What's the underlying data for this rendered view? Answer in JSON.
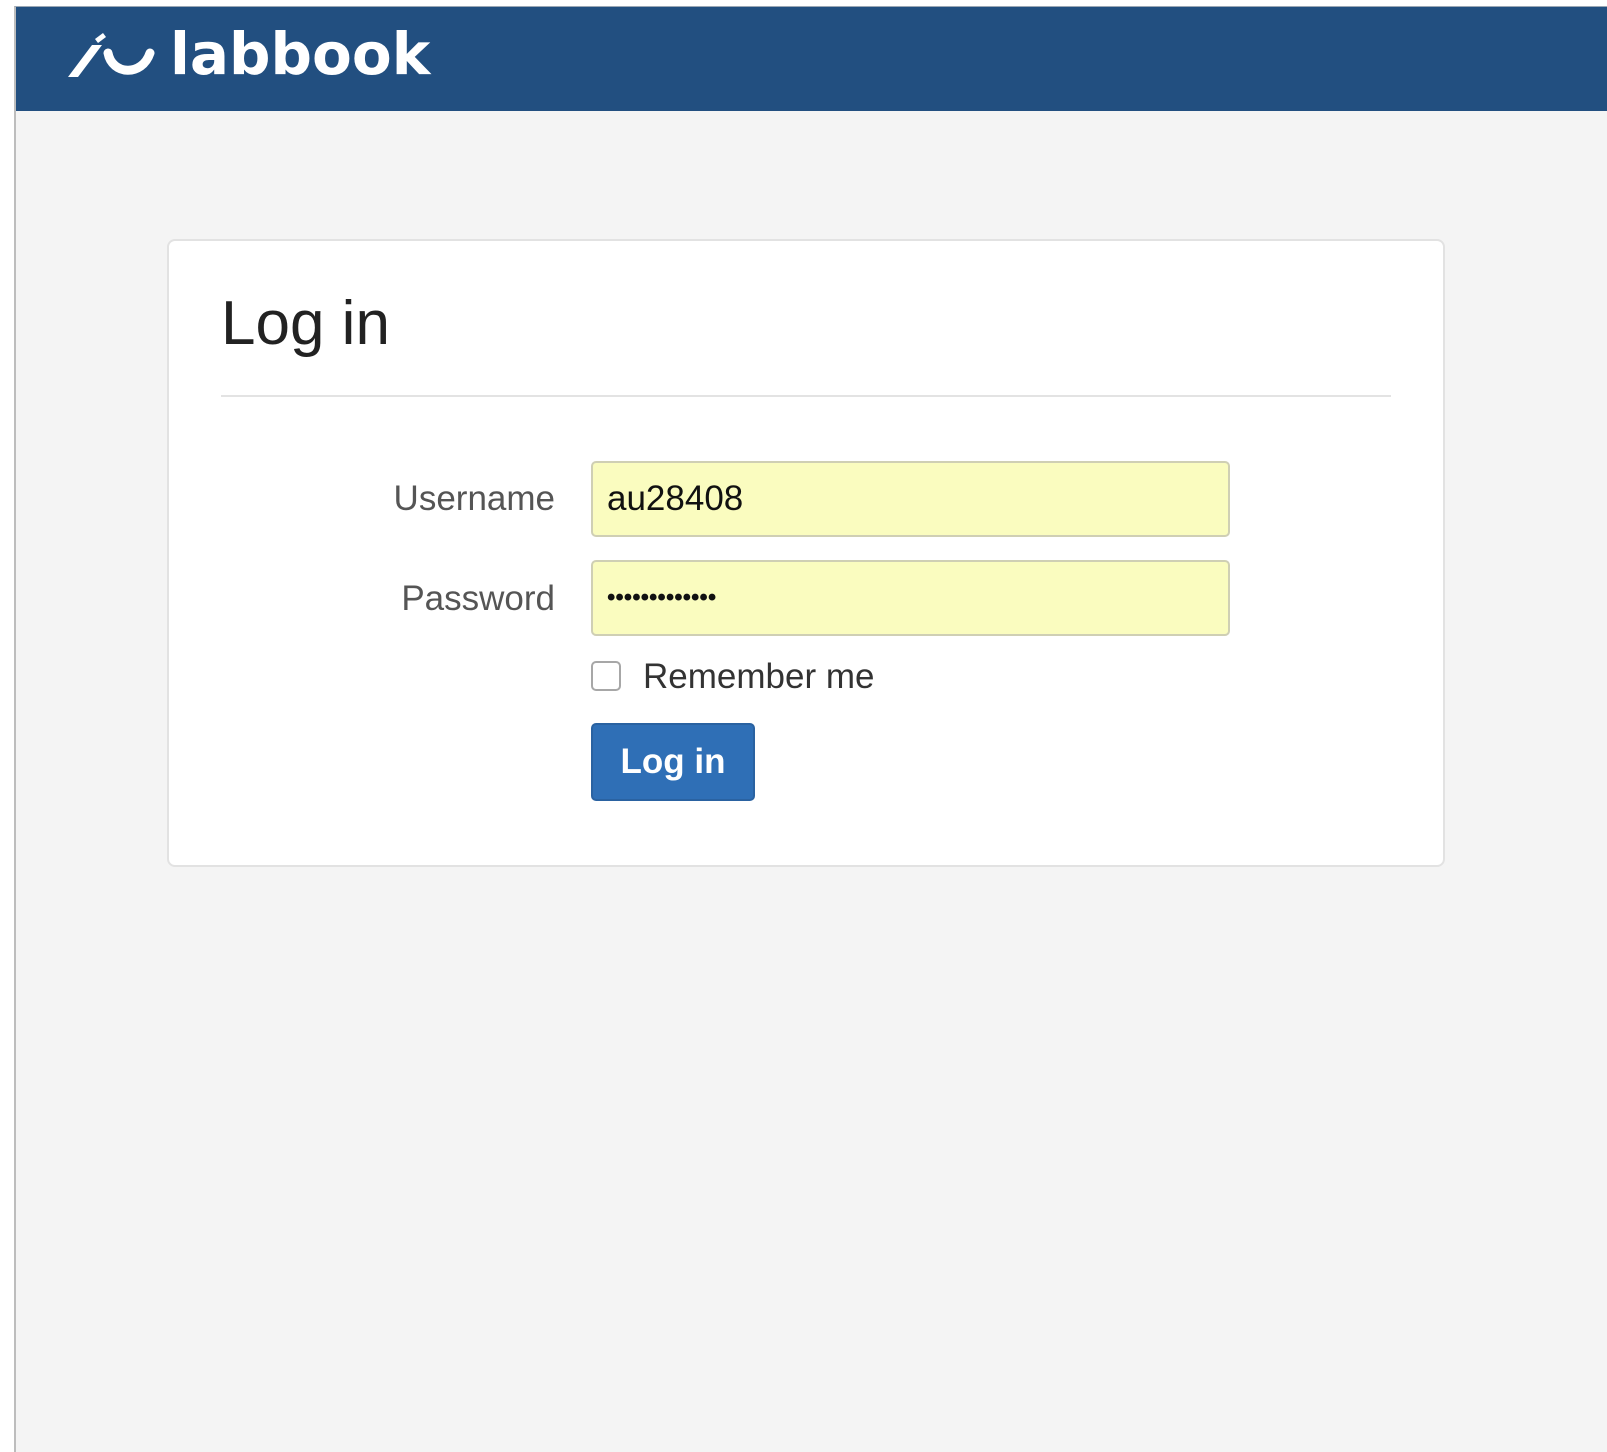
{
  "colors": {
    "navbar_bg": "#224f80",
    "page_bg": "#f4f4f4",
    "input_autofill_bg": "#fafcbf",
    "primary_button": "#2f6fb6"
  },
  "navbar": {
    "brand_name": "labbook",
    "logo_icon": "labbook-logo-icon"
  },
  "login_panel": {
    "title": "Log in",
    "username": {
      "label": "Username",
      "value": "au28408"
    },
    "password": {
      "label": "Password",
      "masked_value": "•••••••••••••"
    },
    "remember_me": {
      "label": "Remember me",
      "checked": false
    },
    "submit_label": "Log in"
  }
}
